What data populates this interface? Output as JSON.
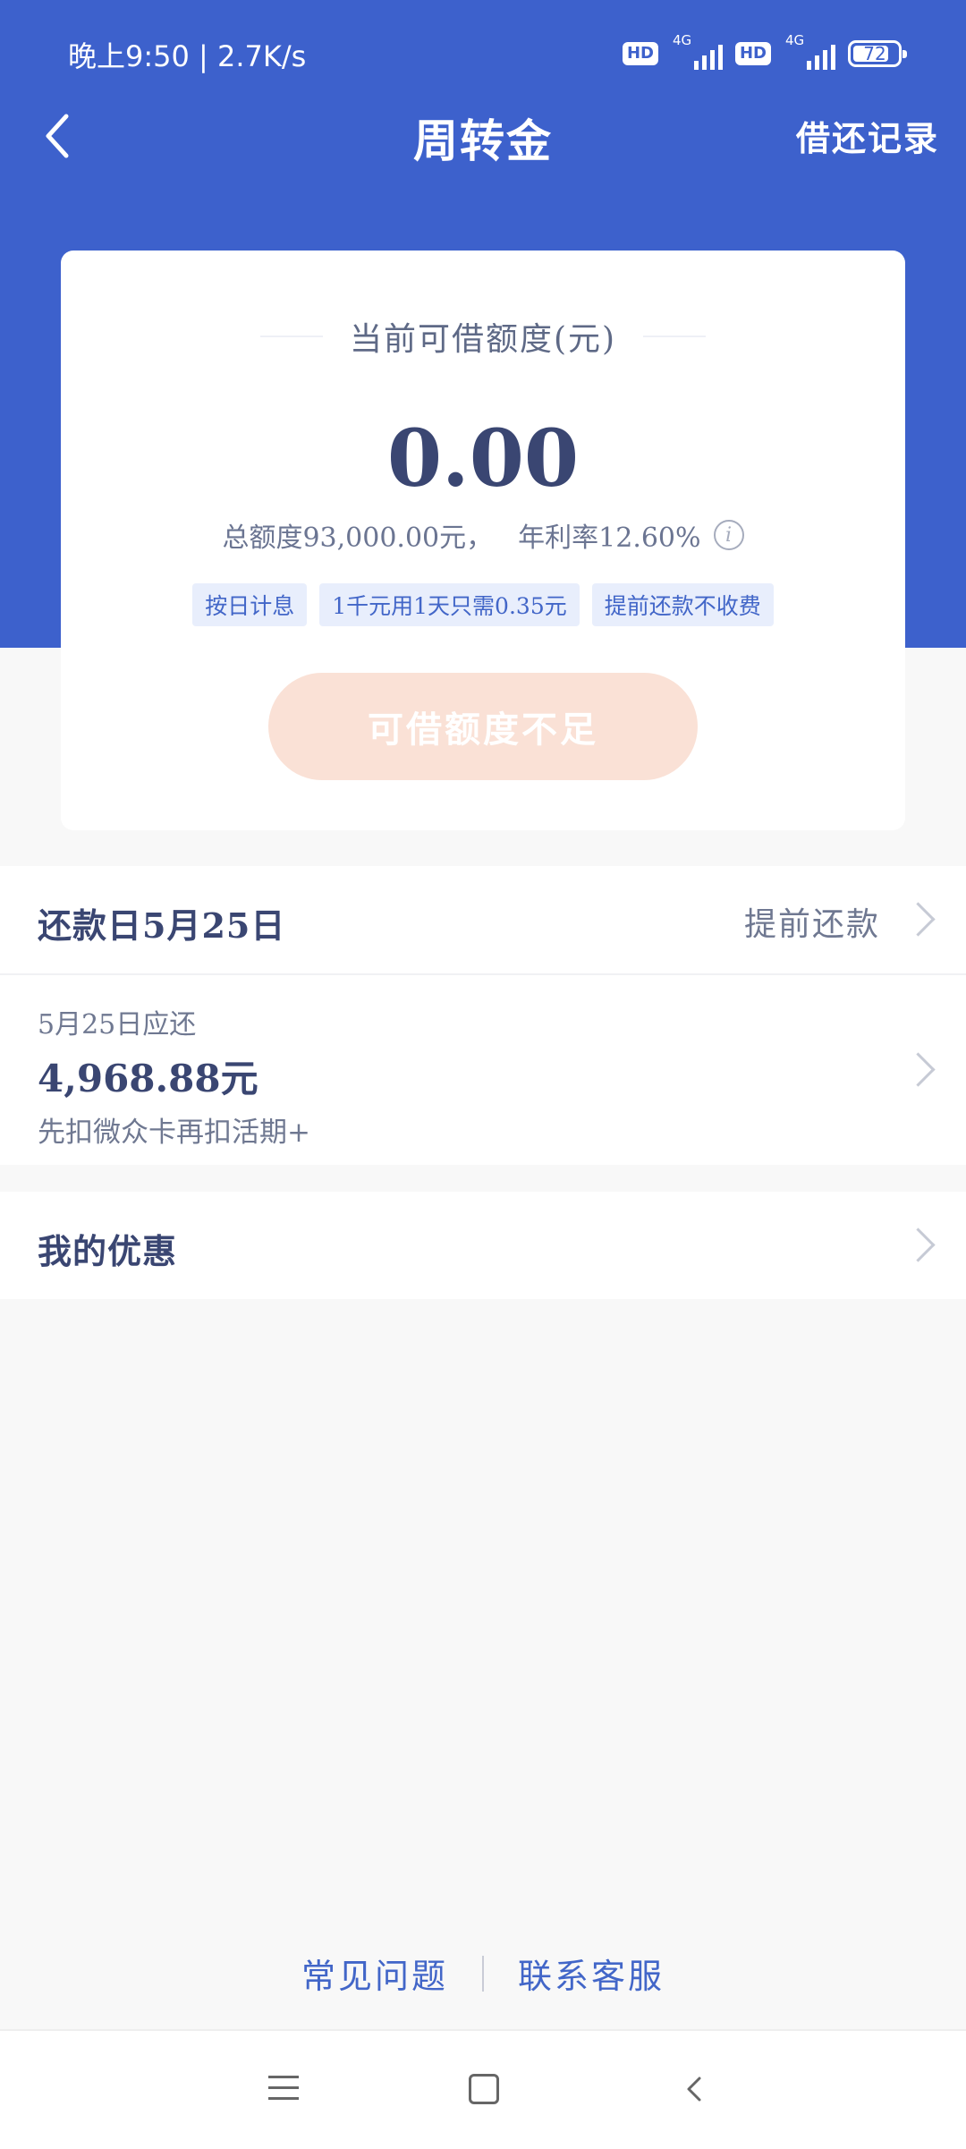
{
  "status_bar": {
    "time_speed": "晚上9:50 | 2.7K/s",
    "hd": "HD",
    "network": "4G",
    "battery": "72"
  },
  "nav": {
    "title": "周转金",
    "records_label": "借还记录"
  },
  "credit_card": {
    "label": "当前可借额度(元)",
    "available_amount": "0.00",
    "total_quota": "总额度93,000.00元，",
    "annual_rate": "年利率12.60%",
    "tags": [
      "按日计息",
      "1千元用1天只需0.35元",
      "提前还款不收费"
    ],
    "borrow_button": "可借额度不足"
  },
  "repayment": {
    "title": "还款日5月25日",
    "early_repay": "提前还款",
    "due_label": "5月25日应还",
    "due_amount": "4,968.88元",
    "deduction_note": "先扣微众卡再扣活期+"
  },
  "offers": {
    "title": "我的优惠"
  },
  "footer": {
    "faq": "常见问题",
    "customer_service": "联系客服"
  },
  "colors": {
    "header_blue": "#3d61cc",
    "button_disabled": "#fae1d6",
    "tag_bg": "#e8eefc",
    "link_blue": "#4266c8"
  }
}
